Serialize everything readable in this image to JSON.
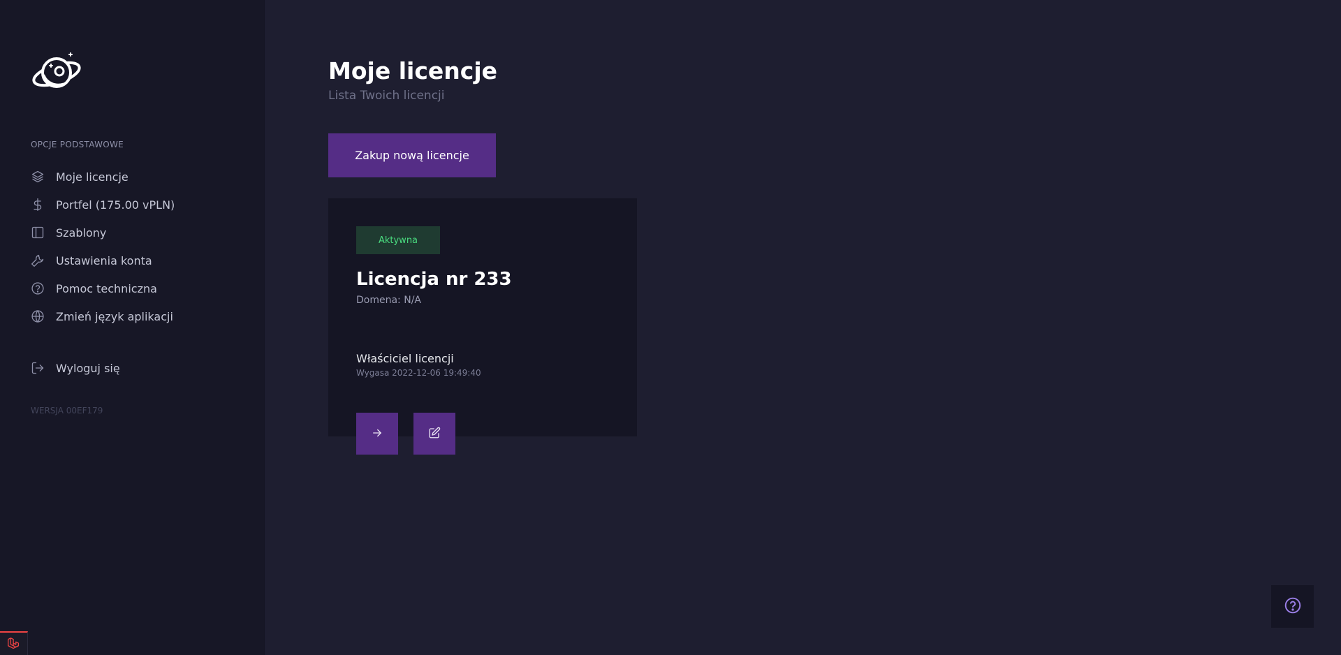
{
  "sidebar": {
    "logo_icon": "planet-astronaut-logo",
    "section_label": "OPCJE PODSTAWOWE",
    "items": [
      {
        "label": "Moje licencje",
        "icon": "layers-icon"
      },
      {
        "label": "Portfel (175.00 vPLN)",
        "icon": "dollar-icon"
      },
      {
        "label": "Szablony",
        "icon": "sidebar-layout-icon"
      },
      {
        "label": "Ustawienia konta",
        "icon": "wrench-icon"
      },
      {
        "label": "Pomoc techniczna",
        "icon": "help-circle-icon"
      },
      {
        "label": "Zmień język aplikacji",
        "icon": "globe-icon"
      }
    ],
    "logout": {
      "label": "Wyloguj się",
      "icon": "logout-icon"
    },
    "version": "WERSJA 00EF179"
  },
  "main": {
    "title": "Moje licencje",
    "subtitle": "Lista Twoich licencji",
    "buy_button": "Zakup nową licencje",
    "license": {
      "status": "Aktywna",
      "title": "Licencja nr 233",
      "domain": "Domena: N/A",
      "owner_label": "Właściciel licencji",
      "expires": "Wygasa 2022-12-06 19:49:40"
    }
  },
  "colors": {
    "background": "#1e1e30",
    "sidebar": "#171726",
    "accent": "#552d86",
    "status_active": "#4ade80",
    "help_icon": "#9b7fe8"
  }
}
